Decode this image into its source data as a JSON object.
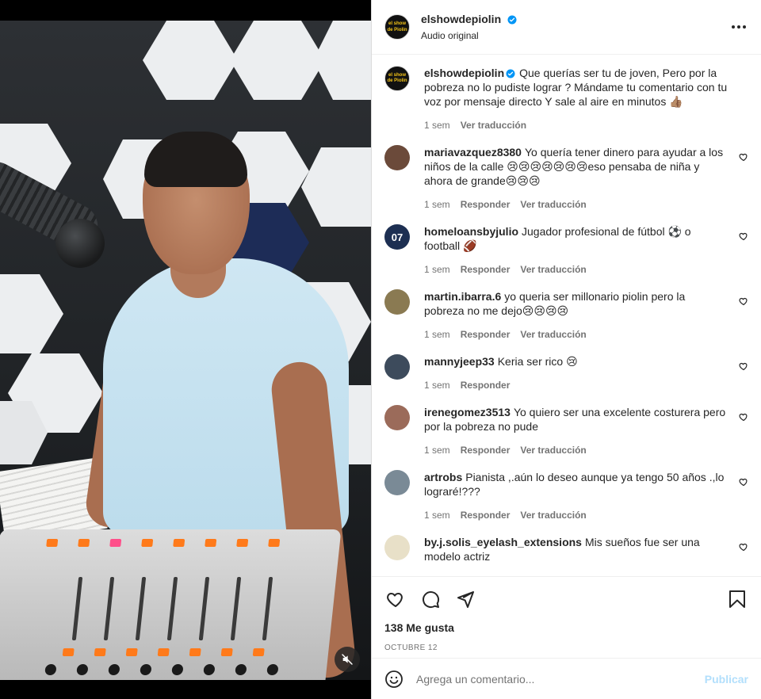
{
  "post": {
    "username": "elshowdepiolin",
    "subtitle": "Audio original",
    "logo_text": "el show de Piolin",
    "caption": {
      "username": "elshowdepiolin",
      "text": "Que querías ser tu de joven, Pero por la pobreza no lo pudiste lograr ? Mándame tu comentario con tu voz por mensaje directo Y sale al aire en minutos 👍🏽",
      "time": "1 sem",
      "translate": "Ver traducción"
    }
  },
  "comments": [
    {
      "username": "mariavazquez8380",
      "text": "Yo quería tener dinero para ayudar a los niños de la calle 😢😢😢😢😢😢😢eso pensaba de niña y ahora de grande😢😢😢",
      "time": "1 sem",
      "reply": "Responder",
      "translate": "Ver traducción",
      "avatar_color": "#6b4a3a"
    },
    {
      "username": "homeloansbyjulio",
      "text": "Jugador profesional de fútbol ⚽ o football 🏈",
      "time": "1 sem",
      "reply": "Responder",
      "translate": "Ver traducción",
      "avatar_color": "#1d2f52",
      "avatar_text": "07"
    },
    {
      "username": "martin.ibarra.6",
      "text": "yo queria ser millonario piolin pero la pobreza no me dejo😢😢😢😢",
      "time": "1 sem",
      "reply": "Responder",
      "translate": "Ver traducción",
      "avatar_color": "#8a7a52"
    },
    {
      "username": "mannyjeep33",
      "text": "Keria ser rico 😢",
      "time": "1 sem",
      "reply": "Responder",
      "translate": "",
      "avatar_color": "#3d4b5c"
    },
    {
      "username": "irenegomez3513",
      "text": "Yo quiero ser una excelente costurera pero por la pobreza no pude",
      "time": "1 sem",
      "reply": "Responder",
      "translate": "Ver traducción",
      "avatar_color": "#9b6b5a"
    },
    {
      "username": "artrobs",
      "text": "Pianista ,.aún lo deseo aunque ya tengo 50 años .,lo lograré!???",
      "time": "1 sem",
      "reply": "Responder",
      "translate": "Ver traducción",
      "avatar_color": "#7a8a96"
    },
    {
      "username": "by.j.solis_eyelash_extensions",
      "text": "Mis sueños fue ser una modelo actriz",
      "time": "",
      "reply": "",
      "translate": "",
      "avatar_color": "#e8e0c8"
    }
  ],
  "likes": "138 Me gusta",
  "date": "OCTUBRE 12",
  "add_comment": {
    "placeholder": "Agrega un comentario...",
    "publish": "Publicar"
  },
  "colors": {
    "verified": "#0095f6",
    "publish_disabled": "#b2dffc",
    "meta_text": "#737373"
  }
}
